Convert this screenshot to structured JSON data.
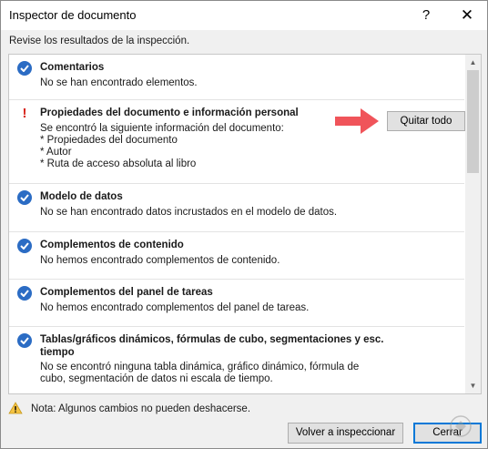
{
  "window": {
    "title": "Inspector de documento",
    "help_label": "?",
    "close_label": "✕"
  },
  "subtitle": "Revise los resultados de la inspección.",
  "items": [
    {
      "status": "ok",
      "title": "Comentarios",
      "description": [
        "No se han encontrado elementos."
      ]
    },
    {
      "status": "warning",
      "title": "Propiedades del documento e información personal",
      "description": [
        "Se encontró la siguiente información del documento:",
        "* Propiedades del documento",
        "* Autor",
        "* Ruta de acceso absoluta al libro"
      ],
      "action_label": "Quitar todo"
    },
    {
      "status": "ok",
      "title": "Modelo de datos",
      "description": [
        "No se han encontrado datos incrustados en el modelo de datos."
      ]
    },
    {
      "status": "ok",
      "title": "Complementos de contenido",
      "description": [
        "No hemos encontrado complementos de contenido."
      ]
    },
    {
      "status": "ok",
      "title": "Complementos del panel de tareas",
      "description": [
        "No hemos encontrado complementos del panel de tareas."
      ]
    },
    {
      "status": "ok",
      "title": "Tablas/gráficos dinámicos, fórmulas de cubo, segmentaciones y esc. tiempo",
      "description": [
        "No se encontró ninguna tabla dinámica, gráfico dinámico, fórmula de",
        "cubo, segmentación de datos ni escala de tiempo."
      ]
    }
  ],
  "note": "Nota: Algunos cambios no pueden deshacerse.",
  "buttons": {
    "reinspect": "Volver a inspeccionar",
    "close": "Cerrar"
  },
  "colors": {
    "check": "#2b6cc4",
    "warning": "#d8261c",
    "arrow": "#f0545a",
    "accent_border": "#0078d7"
  },
  "icons": {
    "ok": "checkmark-circle-icon",
    "warning": "exclamation-icon",
    "note": "warning-triangle-icon",
    "pointer": "arrow-right-icon"
  }
}
